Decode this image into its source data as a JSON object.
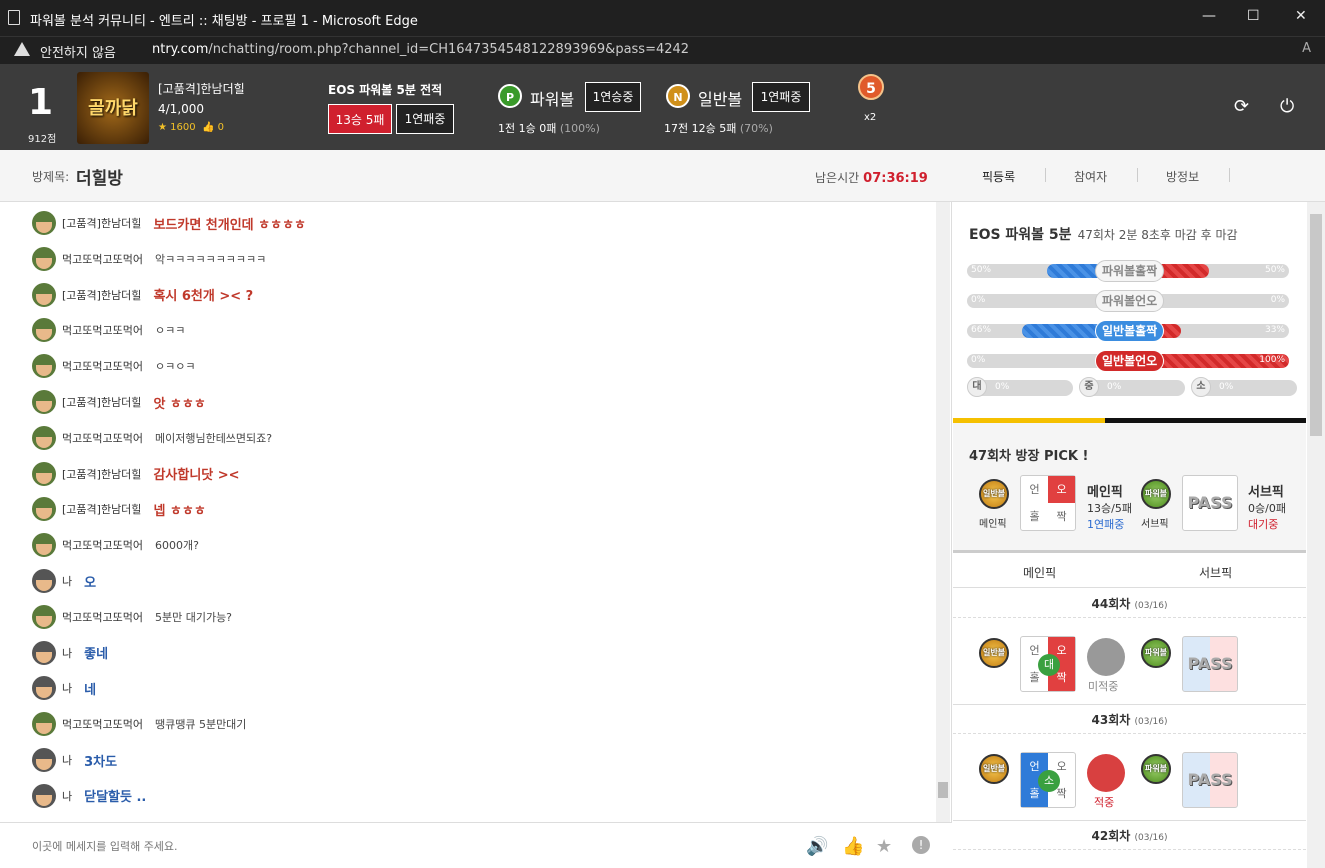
{
  "window": {
    "title": "파워볼 분석 커뮤니티 - 엔트리 :: 채팅방 - 프로필 1 - Microsoft Edge",
    "min": "—",
    "max": "☐",
    "close": "✕"
  },
  "address": {
    "warning": "안전하지 않음",
    "domain": "ntry.com",
    "path": "/nchatting/room.php?channel_id=CH1647354548122893969&pass=4242",
    "read_aloud": "A"
  },
  "profile": {
    "rank": "1",
    "points": "912점",
    "avatar_text": "골까닭",
    "name": "[고품격]한남더힐",
    "count": "4/1,000",
    "stars": "★ 1600",
    "likes": "👍 0"
  },
  "stats": {
    "title": "EOS 파워볼 5분 전적",
    "record": "13승 5패",
    "streak": "1연패중"
  },
  "powerball": {
    "ball": "P",
    "label": "파워볼",
    "streak": "1연승중",
    "record": "1전 1승 0패",
    "pct": "(100%)"
  },
  "normal": {
    "ball": "N",
    "label": "일반볼",
    "streak": "1연패중",
    "record": "17전 12승 5패",
    "pct": "(70%)"
  },
  "medal": {
    "num": "5",
    "mult": "x2"
  },
  "icons": {
    "refresh": "⟳",
    "power": "⏻"
  },
  "room": {
    "label": "방제목:",
    "name": "더힐방",
    "remain_label": "남은시간",
    "remain": "07:36:19",
    "tabs": [
      "픽등록",
      "참여자",
      "방정보"
    ]
  },
  "chat": [
    {
      "user": "[고품격]한남더힐",
      "text": "보드카면 천개인데 ㅎㅎㅎㅎ",
      "style": "red",
      "me": false
    },
    {
      "user": "먹고또먹고또먹어",
      "text": "악ㅋㅋㅋㅋㅋㅋㅋㅋㅋㅋ",
      "style": "plain",
      "me": false
    },
    {
      "user": "[고품격]한남더힐",
      "text": "혹시 6천개 >< ?",
      "style": "red",
      "me": false
    },
    {
      "user": "먹고또먹고또먹어",
      "text": "ㅇㅋㅋ",
      "style": "plain",
      "me": false
    },
    {
      "user": "먹고또먹고또먹어",
      "text": "ㅇㅋㅇㅋ",
      "style": "plain",
      "me": false
    },
    {
      "user": "[고품격]한남더힐",
      "text": "앗 ㅎㅎㅎ",
      "style": "red",
      "me": false
    },
    {
      "user": "먹고또먹고또먹어",
      "text": "메이저행님한테쓰면되죠?",
      "style": "plain",
      "me": false
    },
    {
      "user": "[고품격]한남더힐",
      "text": "감사합니닷 ><",
      "style": "red",
      "me": false
    },
    {
      "user": "[고품격]한남더힐",
      "text": "넵 ㅎㅎㅎ",
      "style": "red",
      "me": false
    },
    {
      "user": "먹고또먹고또먹어",
      "text": "6000개?",
      "style": "plain",
      "me": false
    },
    {
      "user": "나",
      "text": "오",
      "style": "blue",
      "me": true
    },
    {
      "user": "먹고또먹고또먹어",
      "text": "5분만 대기가능?",
      "style": "plain",
      "me": false
    },
    {
      "user": "나",
      "text": "좋네",
      "style": "blue",
      "me": true
    },
    {
      "user": "나",
      "text": "네",
      "style": "blue",
      "me": true
    },
    {
      "user": "먹고또먹고또먹어",
      "text": "땡큐땡큐 5분만대기",
      "style": "plain",
      "me": false
    },
    {
      "user": "나",
      "text": "3차도",
      "style": "blue",
      "me": true
    },
    {
      "user": "나",
      "text": "닫달할듯 ..",
      "style": "blue",
      "me": true
    }
  ],
  "input": {
    "placeholder": "이곳에 메세지를 입력해 주세요.",
    "icons": [
      "🔊",
      "👍",
      "★",
      "!"
    ]
  },
  "game": {
    "title": "EOS 파워볼 5분",
    "sub": "47회차 2분 8초후 마감 후 마감",
    "rows": [
      {
        "cap": "파워볼홀짝",
        "left": "50%",
        "right": "50%",
        "l": 0.5,
        "r": 0.5,
        "style": "gray"
      },
      {
        "cap": "파워볼언오",
        "left": "0%",
        "right": "0%",
        "l": 0,
        "r": 0,
        "style": "gray"
      },
      {
        "cap": "일반볼홀짝",
        "left": "66%",
        "right": "33%",
        "l": 0.66,
        "r": 0.33,
        "style": "blue"
      },
      {
        "cap": "일반볼언오",
        "left": "0%",
        "right": "100%",
        "l": 0,
        "r": 1.0,
        "style": "red"
      }
    ],
    "sizes": [
      {
        "c": "대",
        "v": "0%"
      },
      {
        "c": "중",
        "v": "0%"
      },
      {
        "c": "소",
        "v": "0%"
      }
    ]
  },
  "pick": {
    "title": "47회차 방장 PICK !",
    "main_ball": "일반볼",
    "main_label": "메인픽",
    "grid": [
      "언",
      "오",
      "홀",
      "짝"
    ],
    "main_info": {
      "title": "메인픽",
      "record": "13승/5패",
      "streak": "1연패중"
    },
    "sub_ball": "파워볼",
    "sub_label": "서브픽",
    "pass": "PASS",
    "sub_info": {
      "title": "서브픽",
      "record": "0승/0패",
      "streak": "대기중"
    }
  },
  "history": {
    "cols": [
      "메인픽",
      "서브픽"
    ],
    "rounds": [
      {
        "round": "44회차",
        "date": "(03/16)",
        "ball": "일반볼",
        "grid": [
          "언",
          "오",
          "홀",
          "짝"
        ],
        "mark": "대",
        "status": "미적중",
        "sub_ball": "파워볼",
        "pass": "PASS"
      },
      {
        "round": "43회차",
        "date": "(03/16)",
        "ball": "일반볼",
        "grid": [
          "언",
          "오",
          "홀",
          "짝"
        ],
        "mark": "소",
        "status": "적중",
        "sub_ball": "파워볼",
        "pass": "PASS"
      },
      {
        "round": "42회차",
        "date": "(03/16)"
      }
    ]
  }
}
